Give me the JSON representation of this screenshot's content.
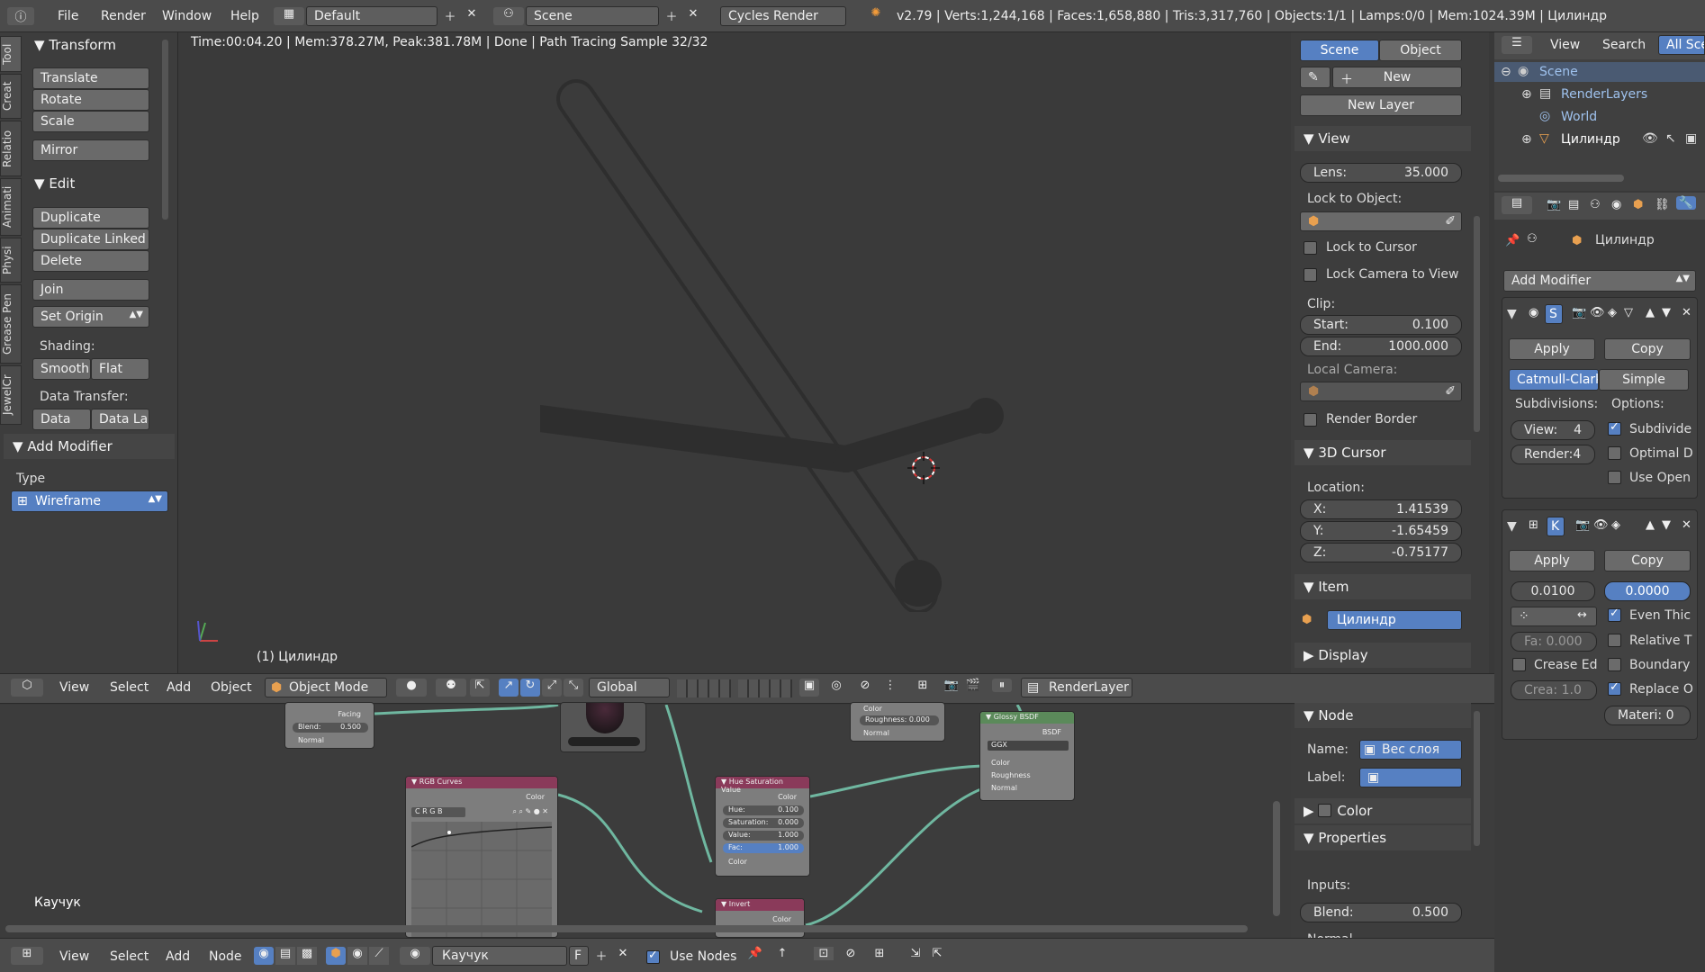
{
  "topbar": {
    "menu": [
      "File",
      "Render",
      "Window",
      "Help"
    ],
    "layout": "Default",
    "scene": "Scene",
    "engine": "Cycles Render",
    "stats": "v2.79 | Verts:1,244,168 | Faces:1,658,880 | Tris:3,317,760 | Objects:1/1 | Lamps:0/0 | Mem:1024.39M | Цилиндр"
  },
  "viewport": {
    "render_info": "Time:00:04.20 | Mem:378.27M, Peak:381.78M | Done | Path Tracing Sample 32/32",
    "object_label": "(1) Цилиндр"
  },
  "tool_tabs": [
    "Tool",
    "Creat",
    "Relatio",
    "Animati",
    "Physi",
    "Grease Pen",
    "JewelCr"
  ],
  "tools": {
    "transform": "Transform",
    "translate": "Translate",
    "rotate": "Rotate",
    "scale": "Scale",
    "mirror": "Mirror",
    "edit": "Edit",
    "duplicate": "Duplicate",
    "duplicate_linked": "Duplicate Linked",
    "delete": "Delete",
    "join": "Join",
    "set_origin": "Set Origin",
    "shading": "Shading:",
    "smooth": "Smooth",
    "flat": "Flat",
    "data_transfer": "Data Transfer:",
    "data": "Data",
    "data_la": "Data La",
    "add_modifier": "Add Modifier",
    "type": "Type",
    "type_value": "Wireframe"
  },
  "viewport_header": {
    "menu": [
      "View",
      "Select",
      "Add",
      "Object"
    ],
    "mode": "Object Mode",
    "orientation": "Global",
    "render_layer": "RenderLayer"
  },
  "properties_n": {
    "scene_tab": "Scene",
    "object_tab": "Object",
    "new": "New",
    "new_layer": "New Layer",
    "view": "View",
    "lens_label": "Lens:",
    "lens_value": "35.000",
    "lock_to_object": "Lock to Object:",
    "lock_to_cursor": "Lock to Cursor",
    "lock_camera": "Lock Camera to View",
    "clip": "Clip:",
    "clip_start_label": "Start:",
    "clip_start": "0.100",
    "clip_end_label": "End:",
    "clip_end": "1000.000",
    "local_camera": "Local Camera:",
    "render_border": "Render Border",
    "cursor": "3D Cursor",
    "location": "Location:",
    "x_label": "X:",
    "x": "1.41539",
    "y_label": "Y:",
    "y": "-1.65459",
    "z_label": "Z:",
    "z": "-0.75177",
    "item": "Item",
    "item_name": "Цилиндр",
    "display": "Display"
  },
  "outliner": {
    "menu": [
      "View",
      "Search",
      "All Sce"
    ],
    "items": [
      "Scene",
      "RenderLayers",
      "World",
      "Цилиндр"
    ]
  },
  "modifiers": {
    "object_name": "Цилиндр",
    "add_modifier": "Add Modifier",
    "apply": "Apply",
    "copy": "Copy",
    "catmull": "Catmull-Clark",
    "simple": "Simple",
    "subdivisions": "Subdivisions:",
    "options": "Options:",
    "view": "View:",
    "view_val": "4",
    "render": "Render:",
    "render_val": "4",
    "subdivide": "Subdivide",
    "optimal": "Optimal D",
    "use_open": "Use Open",
    "apply2": "Apply",
    "copy2": "Copy",
    "thickness": "0.0100",
    "offset": "0.0000",
    "even_thic": "Even Thic",
    "relative": "Relative T",
    "fa": "Fa: 0.000",
    "crease_ed": "Crease Ed",
    "boundary": "Boundary",
    "crea": "Crea: 1.0",
    "replace": "Replace O",
    "materi": "Materi: 0"
  },
  "node_panel": {
    "node": "Node",
    "name_label": "Name:",
    "name": "Вес слоя",
    "label_label": "Label:",
    "color": "Color",
    "properties": "Properties",
    "inputs": "Inputs:",
    "blend_label": "Blend:",
    "blend": "0.500",
    "normal": "Normal"
  },
  "node_editor": {
    "material": "Каучук",
    "menu": [
      "View",
      "Select",
      "Add",
      "Node"
    ],
    "mat_name": "Каучук",
    "use_nodes": "Use Nodes",
    "f": "F"
  },
  "nodes": {
    "rgb_curves": "RGB Curves",
    "hsv": "Hue Saturation Value",
    "glossy": "Glossy BSDF",
    "invert": "Invert",
    "color": "Color",
    "hue": "Hue:",
    "hue_v": "0.100",
    "sat": "Saturation:",
    "sat_v": "0.000",
    "val": "Value:",
    "val_v": "1.000",
    "fac": "Fac:",
    "fac_v": "1.000",
    "bsdf": "BSDF",
    "ggx": "GGX",
    "roughness": "Roughness",
    "normal": "Normal",
    "roughness_v": "Roughness: 0.000",
    "facing": "Facing",
    "blend": "Blend:",
    "blend_v": "0.500"
  },
  "colors": {
    "accent": "#5680c2",
    "bg": "#393939",
    "node_green": "#6fb7a0"
  }
}
